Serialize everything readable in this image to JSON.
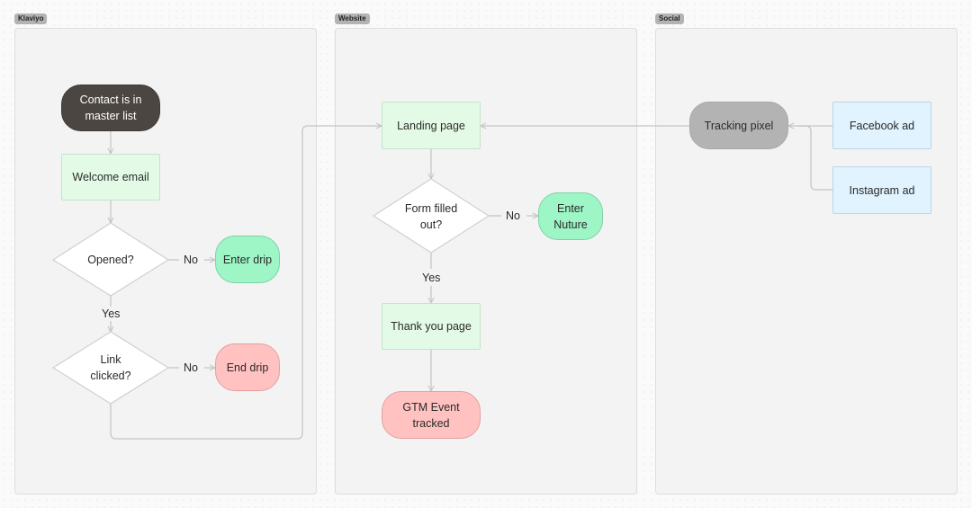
{
  "lanes": [
    {
      "id": "klaviyo",
      "label": "Klaviyo"
    },
    {
      "id": "website",
      "label": "Website"
    },
    {
      "id": "social",
      "label": "Social"
    }
  ],
  "nodes": {
    "contact": {
      "label": "Contact is in master list",
      "shape": "pill",
      "color": "#4b4641"
    },
    "welcome_email": {
      "label": "Welcome email",
      "shape": "rect",
      "color": "#e3fbe6"
    },
    "opened": {
      "label": "Opened?",
      "shape": "diamond"
    },
    "enter_drip": {
      "label": "Enter drip",
      "shape": "pill",
      "color": "#9ef5c5"
    },
    "link_clicked": {
      "label": "Link clicked?",
      "shape": "diamond"
    },
    "end_drip": {
      "label": "End drip",
      "shape": "pill",
      "color": "#ffc2c0"
    },
    "landing_page": {
      "label": "Landing page",
      "shape": "rect",
      "color": "#e3fbe6"
    },
    "form_filled": {
      "label": "Form filled out?",
      "shape": "diamond"
    },
    "enter_nuture": {
      "label": "Enter Nuture",
      "shape": "pill",
      "color": "#9ef5c5"
    },
    "thank_you": {
      "label": "Thank you page",
      "shape": "rect",
      "color": "#e3fbe6"
    },
    "gtm_event": {
      "label": "GTM Event tracked",
      "shape": "pill",
      "color": "#ffc2c0"
    },
    "tracking_pixel": {
      "label": "Tracking pixel",
      "shape": "pill",
      "color": "#b3b3b3"
    },
    "facebook_ad": {
      "label": "Facebook ad",
      "shape": "rect",
      "color": "#e0f3fe"
    },
    "instagram_ad": {
      "label": "Instagram ad",
      "shape": "rect",
      "color": "#e0f3fe"
    }
  },
  "edges": [
    {
      "from": "contact",
      "to": "welcome_email",
      "label": ""
    },
    {
      "from": "welcome_email",
      "to": "opened",
      "label": ""
    },
    {
      "from": "opened",
      "to": "enter_drip",
      "label": "No"
    },
    {
      "from": "opened",
      "to": "link_clicked",
      "label": "Yes"
    },
    {
      "from": "link_clicked",
      "to": "end_drip",
      "label": "No"
    },
    {
      "from": "link_clicked",
      "to": "landing_page",
      "label": ""
    },
    {
      "from": "landing_page",
      "to": "form_filled",
      "label": ""
    },
    {
      "from": "form_filled",
      "to": "enter_nuture",
      "label": "No"
    },
    {
      "from": "form_filled",
      "to": "thank_you",
      "label": "Yes"
    },
    {
      "from": "thank_you",
      "to": "gtm_event",
      "label": ""
    },
    {
      "from": "tracking_pixel",
      "to": "landing_page",
      "label": ""
    },
    {
      "from": "facebook_ad",
      "to": "tracking_pixel",
      "label": ""
    },
    {
      "from": "instagram_ad",
      "to": "tracking_pixel",
      "label": ""
    }
  ],
  "edge_labels": {
    "opened_no": "No",
    "opened_yes": "Yes",
    "link_no": "No",
    "form_no": "No",
    "form_yes": "Yes"
  },
  "colors": {
    "edge": "#c4c4c4",
    "lane_bg": "#f3f3f3",
    "lane_tag": "#b3b3b3"
  }
}
